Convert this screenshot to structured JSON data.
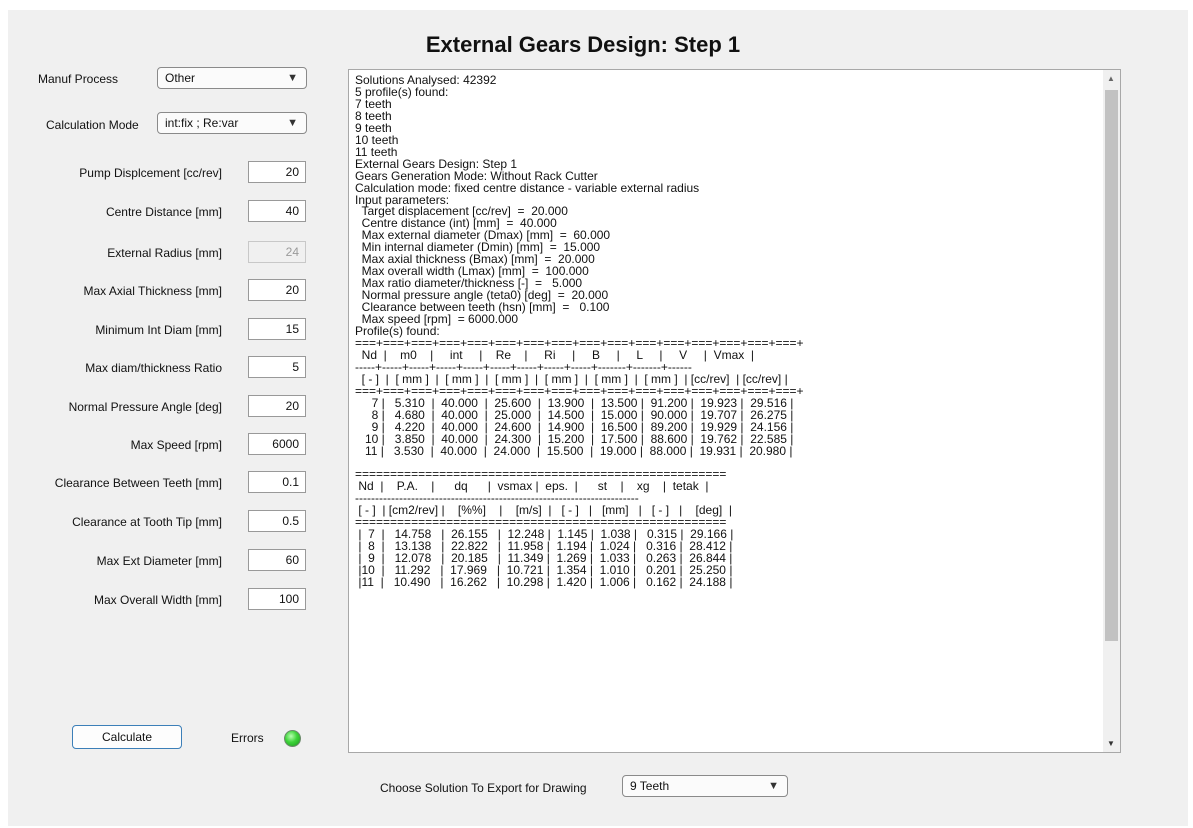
{
  "title": "External Gears Design: Step 1",
  "controls": {
    "manuf_process": {
      "label": "Manuf Process",
      "value": "Other"
    },
    "calc_mode": {
      "label": "Calculation Mode",
      "value": "int:fix ; Re:var"
    },
    "fields": [
      {
        "label": "Pump Displcement [cc/rev]",
        "value": "20"
      },
      {
        "label": "Centre Distance [mm]",
        "value": "40"
      },
      {
        "label": "External Radius [mm]",
        "value": "24"
      },
      {
        "label": "Max Axial Thickness [mm]",
        "value": "20"
      },
      {
        "label": "Minimum Int Diam [mm]",
        "value": "15"
      },
      {
        "label": "Max diam/thickness Ratio",
        "value": "5"
      },
      {
        "label": "Normal Pressure Angle [deg]",
        "value": "20"
      },
      {
        "label": "Max Speed [rpm]",
        "value": "6000"
      },
      {
        "label": "Clearance Between Teeth [mm]",
        "value": "0.1"
      },
      {
        "label": "Clearance at Tooth Tip [mm]",
        "value": "0.5"
      },
      {
        "label": "Max Ext Diameter [mm]",
        "value": "60"
      },
      {
        "label": "Max Overall Width [mm]",
        "value": "100"
      }
    ],
    "calculate_label": "Calculate",
    "errors_label": "Errors",
    "errors_color": "#3ed33a"
  },
  "output_lines": [
    "Solutions Analysed: 42392",
    "5 profile(s) found:",
    "7 teeth",
    "8 teeth",
    "9 teeth",
    "10 teeth",
    "11 teeth",
    "External Gears Design: Step 1",
    "Gears Generation Mode: Without Rack Cutter",
    "Calculation mode: fixed centre distance - variable external radius",
    "Input parameters:",
    "  Target displacement [cc/rev]  =  20.000",
    "  Centre distance (int) [mm]  =  40.000",
    "  Max external diameter (Dmax) [mm]  =  60.000",
    "  Min internal diameter (Dmin) [mm]  =  15.000",
    "  Max axial thickness (Bmax) [mm]  =  20.000",
    "  Max overall width (Lmax) [mm]  =  100.000",
    "  Max ratio diameter/thickness [-]  =   5.000",
    "  Normal pressure angle (teta0) [deg]  =  20.000",
    "  Clearance between teeth (hsn) [mm]  =   0.100",
    "  Max speed [rpm]  = 6000.000",
    "Profile(s) found:",
    "===+===+===+===+===+===+===+===+===+===+===+===+===+===+===+===+",
    "  Nd  |    m0    |     int     |    Re    |     Ri     |     B     |     L     |     V     |  Vmax  |",
    "-----+-----+-----+-----+-----+-----+-----+-----+-----+-------+-------+------",
    "  [ - ]  |  [ mm ]  |  [ mm ]  |  [ mm ]  |  [ mm ]  |  [ mm ]  |  [ mm ]  | [cc/rev]  | [cc/rev] |",
    "===+===+===+===+===+===+===+===+===+===+===+===+===+===+===+===+",
    "     7 |   5.310  |  40.000  |  25.600  |  13.900  |  13.500 |  91.200 |  19.923 |  29.516 |",
    "     8 |   4.680  |  40.000  |  25.000  |  14.500  |  15.000 |  90.000 |  19.707 |  26.275 |",
    "     9 |   4.220  |  40.000  |  24.600  |  14.900  |  16.500 |  89.200 |  19.929 |  24.156 |",
    "   10 |   3.850  |  40.000  |  24.300  |  15.200  |  17.500 |  88.600 |  19.762 |  22.585 |",
    "   11 |   3.530  |  40.000  |  24.000  |  15.500  |  19.000 |  88.000 |  19.931 |  20.980 |",
    "",
    "=====================================================",
    " Nd  |    P.A.    |      dq      |  vsmax |  eps.  |      st    |    xg    |  tetak  |",
    "-----------------------------------------------------------------------",
    " [ - ]  | [cm2/rev] |    [%%]    |    [m/s]  |   [ - ]   |   [mm]   |   [ - ]   |    [deg]  |",
    "=====================================================",
    " |  7  |   14.758   |  26.155   |  12.248 |  1.145 |  1.038 |   0.315 |  29.166 |",
    " |  8  |   13.138   |  22.822   |  11.958 |  1.194 |  1.024 |   0.316 |  28.412 |",
    " |  9  |   12.078   |  20.185   |  11.349 |  1.269 |  1.033 |   0.263 |  26.844 |",
    " |10  |   11.292   |  17.969   |  10.721 |  1.354 |  1.010 |   0.201 |  25.250 |",
    " |11  |   10.490   |  16.262   |  10.298 |  1.420 |  1.006 |   0.162 |  24.188 |"
  ],
  "export": {
    "label": "Choose Solution To Export for Drawing",
    "value": "9 Teeth"
  }
}
